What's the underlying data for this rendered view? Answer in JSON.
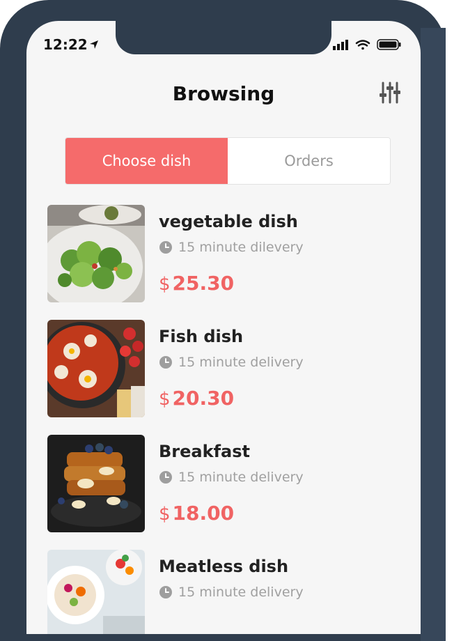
{
  "status_bar": {
    "time": "12:22"
  },
  "header": {
    "title": "Browsing"
  },
  "tabs": [
    {
      "label": "Choose dish",
      "active": true
    },
    {
      "label": "Orders",
      "active": false
    }
  ],
  "dishes": [
    {
      "name": "vegetable dish",
      "delivery": "15 minute dilevery",
      "currency": "$",
      "price": "25.30"
    },
    {
      "name": "Fish dish",
      "delivery": "15 minute delivery",
      "currency": "$",
      "price": "20.30"
    },
    {
      "name": "Breakfast",
      "delivery": "15 minute delivery",
      "currency": "$",
      "price": "18.00"
    },
    {
      "name": "Meatless dish",
      "delivery": "15 minute delivery",
      "currency": "$",
      "price": ""
    }
  ],
  "colors": {
    "accent": "#f56b6b",
    "frame": "#2f3d4d",
    "price": "#f06363"
  },
  "icons": [
    "location-arrow-icon",
    "signal-icon",
    "wifi-icon",
    "battery-icon",
    "filter-sliders-icon",
    "clock-icon"
  ]
}
